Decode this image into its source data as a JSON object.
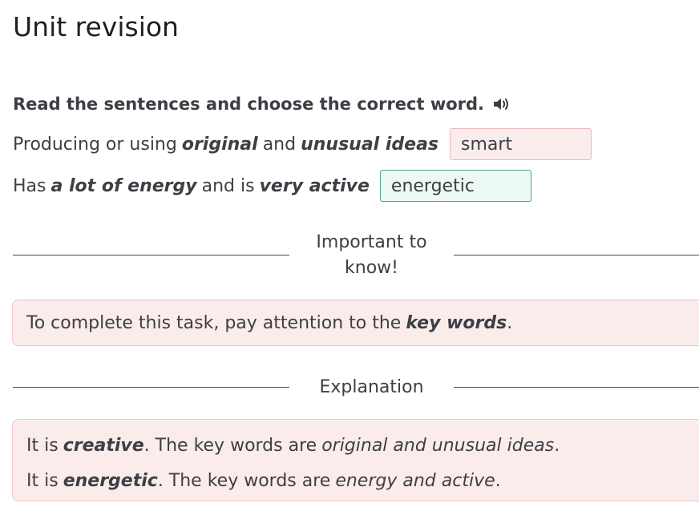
{
  "page": {
    "title": "Unit revision"
  },
  "task": {
    "instruction": "Read the sentences and choose the correct word.",
    "items": [
      {
        "text_before": "Producing or using",
        "keyword_1": "original",
        "text_middle": "and",
        "keyword_2": "unusual ideas",
        "answer": "smart",
        "status": "incorrect"
      },
      {
        "text_before": "Has",
        "keyword_1": "a lot of energy",
        "text_middle": "and is",
        "keyword_2": "very active",
        "answer": "energetic",
        "status": "correct"
      }
    ]
  },
  "tip": {
    "heading_line1": "Important to",
    "heading_line2": "know!",
    "text_before": "To complete this task, pay attention to the",
    "keyword": "key words",
    "text_after": "."
  },
  "explanation": {
    "heading": "Explanation",
    "lines": [
      {
        "prefix": "It is",
        "answer": "creative",
        "middle": ". The key words are",
        "keywords": "original and unusual ideas",
        "suffix": "."
      },
      {
        "prefix": "It is",
        "answer": "energetic",
        "middle": ". The key words are",
        "keywords": "energy and active",
        "suffix": "."
      }
    ]
  },
  "colors": {
    "incorrect_fill": "#fbecec",
    "incorrect_border": "#e8b9bd",
    "correct_fill": "#edf9f4",
    "correct_border": "#4fa48e",
    "panel_fill": "#fbecec"
  },
  "icons": {
    "audio": "speaker-icon"
  }
}
